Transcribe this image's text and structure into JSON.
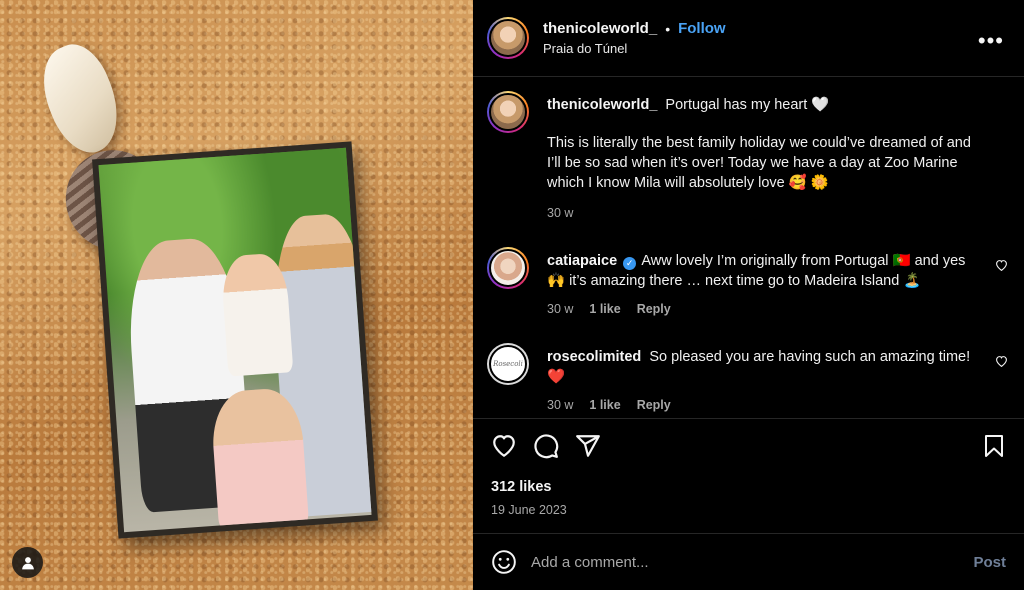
{
  "post": {
    "author": "thenicoleworld_",
    "follow_label": "Follow",
    "separator": "•",
    "location": "Praia do Túnel",
    "more_label": "•••"
  },
  "caption": {
    "username": "thenicoleworld_",
    "line1": "Portugal has my heart 🤍",
    "line2": "This is literally the best family holiday we could’ve dreamed of and I’ll be so sad when it’s over! Today we have a day at Zoo Marine which I know Mila will absolutely love 🥰 🌼",
    "time": "30 w"
  },
  "comments": [
    {
      "username": "catiapaice",
      "verified": true,
      "text": "Aww lovely I’m originally from Portugal 🇵🇹 and yes 🙌 it’s amazing there … next time go to Madeira Island 🏝️",
      "time": "30 w",
      "likes": "1 like",
      "reply": "Reply"
    },
    {
      "username": "rosecolimited",
      "verified": false,
      "text": "So pleased you are having such an amazing time! ❤️",
      "time": "30 w",
      "likes": "1 like",
      "reply": "Reply",
      "avatar_text": "Rosecoli"
    }
  ],
  "stats": {
    "likes": "312 likes",
    "date": "19 June 2023"
  },
  "composer": {
    "placeholder": "Add a comment...",
    "post_label": "Post"
  },
  "colors": {
    "background": "#000000",
    "follow": "#4aa3f5",
    "post_button": "#6f7f98",
    "muted_text": "#a8a8a8",
    "divider": "#262626"
  },
  "icons": {
    "like": "heart-icon",
    "comment": "comment-icon",
    "share": "share-icon",
    "save": "bookmark-icon",
    "more": "more-icon",
    "emoji": "emoji-icon",
    "tag": "user-tag-icon",
    "comment_like": "heart-small-icon"
  }
}
